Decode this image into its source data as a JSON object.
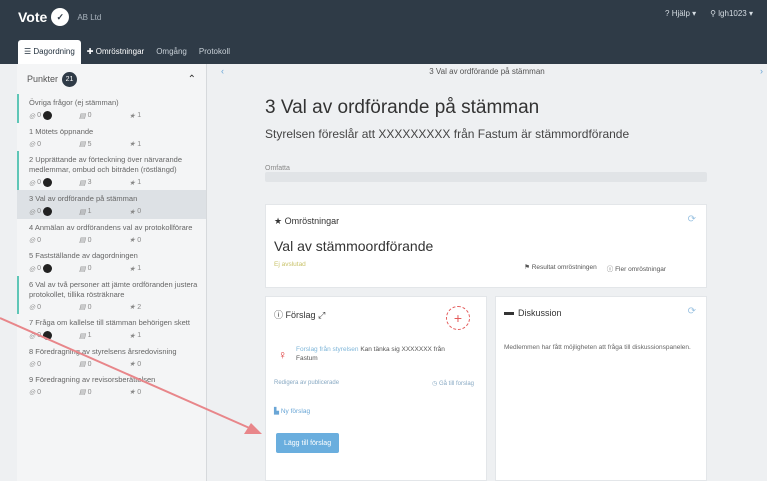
{
  "app": {
    "brand": "Vote",
    "org": "AB Ltd",
    "help": "Hjälp",
    "user": "lgh1023"
  },
  "nav_tabs": [
    {
      "label": "Dagordning"
    },
    {
      "label": "Omröstningar"
    },
    {
      "label": "Omgång"
    },
    {
      "label": "Protokoll"
    }
  ],
  "sidebar": {
    "title": "Punkter",
    "count": "21",
    "items": [
      {
        "title": "Övriga frågor (ej stämman)",
        "a": "0",
        "b": "0",
        "c": "1"
      },
      {
        "title": "1 Mötets öppnande",
        "a": "0",
        "b": "5",
        "c": "1"
      },
      {
        "title": "2 Upprättande av förteckning över närvarande medlemmar, ombud och biträden (röstlängd)",
        "a": "0",
        "b": "3",
        "c": "1"
      },
      {
        "title": "3 Val av ordförande på stämman",
        "a": "0",
        "b": "1",
        "c": "0"
      },
      {
        "title": "4 Anmälan av ordförandens val av protokollförare",
        "a": "0",
        "b": "0",
        "c": "0"
      },
      {
        "title": "5 Fastställande av dagordningen",
        "a": "0",
        "b": "0",
        "c": "1"
      },
      {
        "title": "6 Val av två personer att jämte ordföranden justera protokollet, tillika rösträknare",
        "a": "0",
        "b": "0",
        "c": "2"
      },
      {
        "title": "7 Fråga om kallelse till stämman behörigen skett",
        "a": "0",
        "b": "1",
        "c": "1"
      },
      {
        "title": "8 Föredragning av styrelsens årsredovisning",
        "a": "0",
        "b": "0",
        "c": "0"
      },
      {
        "title": "9 Föredragning av revisorsberättelsen",
        "a": "0",
        "b": "0",
        "c": "0"
      }
    ]
  },
  "main": {
    "breadcrumb": "3 Val av ordförande på stämman",
    "title": "3 Val av ordförande på stämman",
    "subtitle": "Styrelsen föreslår att XXXXXXXXX från Fastum är stämmordförande",
    "tip_label": "Omfatta",
    "omrostningar": {
      "title": "Omröstningar",
      "heading": "Val av stämmoordförande",
      "tag": "Ej avslutad",
      "link1": "Resultat omröstningen",
      "link2": "Fler omröstningar"
    },
    "forslag": {
      "title": "Förslag",
      "plus": "+",
      "author": "Forslag från styrelsen",
      "text": "XXXXXXX från Fastum",
      "text_prefix": "Kan tänka sig",
      "foot_left": "Redigera av publicerade",
      "foot_right": "Gå till forslag",
      "attach": "Ny förslag",
      "add_button": "Lägg till förslag"
    },
    "diskussion": {
      "title": "Diskussion",
      "text": "Medlemmen har fått möjligheten att fråga till diskussionspanelen."
    }
  },
  "colors": {
    "topbar": "#2f3b47",
    "accent": "#6aaede",
    "marker": "#5fc6b7",
    "annotation": "#e8868a"
  }
}
